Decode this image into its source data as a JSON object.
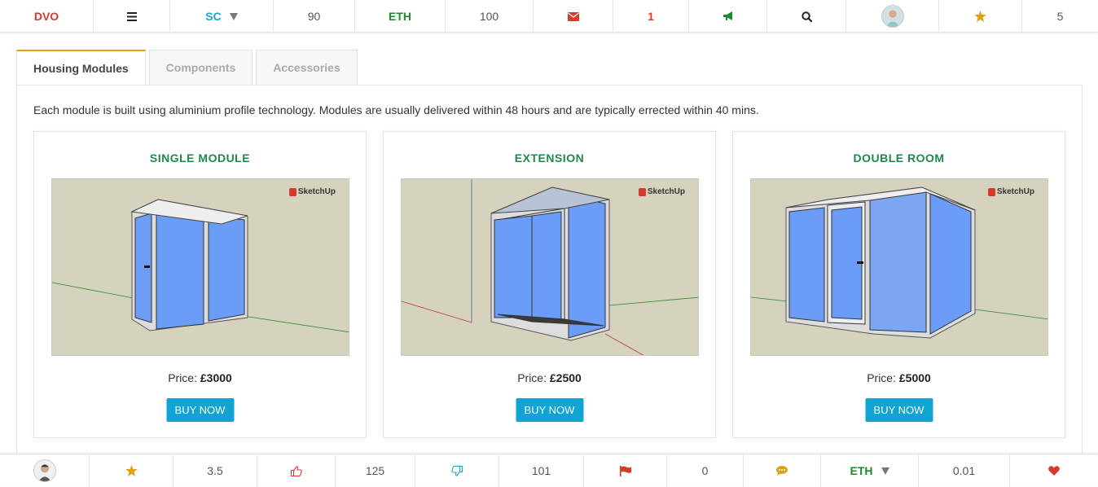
{
  "topbar": {
    "brand": "DVO",
    "currency_sc": "SC",
    "sc_value": "90",
    "currency_eth": "ETH",
    "eth_value": "100",
    "messages_count": "1",
    "rating_count": "5",
    "icons": [
      "hamburger-icon",
      "chevron-down-icon",
      "envelope-icon",
      "megaphone-icon",
      "search-icon",
      "avatar",
      "star-icon"
    ]
  },
  "tabs": [
    {
      "label": "Housing Modules",
      "active": true
    },
    {
      "label": "Components",
      "active": false
    },
    {
      "label": "Accessories",
      "active": false
    }
  ],
  "intro": "Each module is built using aluminium profile technology. Modules are usually delivered within 48 hours and are typically errected within 40 mins.",
  "products": [
    {
      "title": "SINGLE MODULE",
      "price_label": "Price:",
      "price": "£3000",
      "button": "BUY NOW",
      "watermark": "SketchUp"
    },
    {
      "title": "EXTENSION",
      "price_label": "Price:",
      "price": "£2500",
      "button": "BUY NOW",
      "watermark": "SketchUp"
    },
    {
      "title": "DOUBLE ROOM",
      "price_label": "Price:",
      "price": "£5000",
      "button": "BUY NOW",
      "watermark": "SketchUp"
    }
  ],
  "bottombar": {
    "rating": "3.5",
    "likes": "125",
    "dislikes": "101",
    "flags": "0",
    "currency": "ETH",
    "amount": "0.01",
    "icons": [
      "avatar",
      "star-icon",
      "thumbs-up-icon",
      "thumbs-down-icon",
      "flag-icon",
      "comment-icon",
      "chevron-down-icon",
      "heart-icon"
    ]
  },
  "colors": {
    "accent": "#1aa5d0",
    "green": "#1e8a4a",
    "red": "#d9392b",
    "gold": "#e0a01a",
    "button": "#11a3d1"
  }
}
